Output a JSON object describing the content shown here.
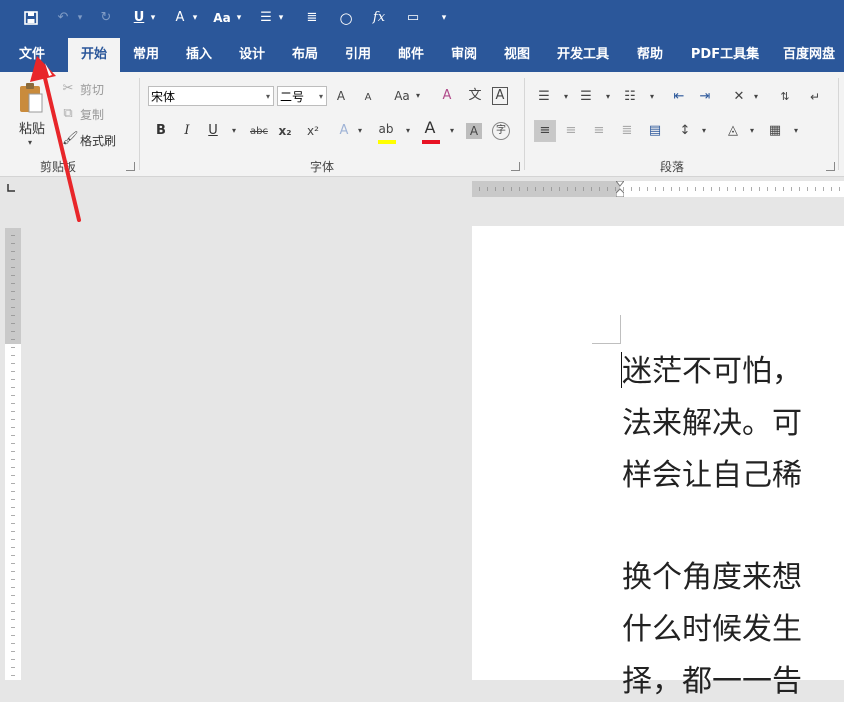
{
  "quick_access": {
    "icons": [
      "save-icon",
      "undo-icon",
      "redo-icon",
      "underline-icon",
      "text-effects-icon",
      "font-size-icon",
      "bullets-icon",
      "align-icon",
      "shape-icon",
      "formula-icon",
      "comment-icon",
      "customize-icon"
    ],
    "underline": "U",
    "font_case": "Aa",
    "formula": "fx"
  },
  "tabs": [
    "文件",
    "开始",
    "常用",
    "插入",
    "设计",
    "布局",
    "引用",
    "邮件",
    "审阅",
    "视图",
    "开发工具",
    "帮助",
    "PDF工具集",
    "百度网盘"
  ],
  "clipboard": {
    "group_label": "剪贴板",
    "paste": "粘贴",
    "cut": "剪切",
    "copy": "复制",
    "format_painter": "格式刷"
  },
  "font": {
    "group_label": "字体",
    "font_name": "宋体",
    "font_size": "二号",
    "grow": "A",
    "shrink": "A",
    "change_case": "Aa",
    "phonetic": "文",
    "border": "A",
    "bold": "B",
    "italic": "I",
    "underline": "U",
    "strikethrough": "abc",
    "subscript": "x₂",
    "superscript": "x²",
    "effects": "A",
    "highlight": "ab",
    "font_color": "A",
    "shading": "A",
    "enclose": "字"
  },
  "paragraph": {
    "group_label": "段落"
  },
  "document": {
    "lines": [
      "迷茫不可怕，",
      "法来解决。可",
      "样会让自己稀",
      "",
      "换个角度来想",
      "什么时候发生",
      "择，都一一告"
    ]
  },
  "colors": {
    "ribbon_blue": "#2b579a",
    "highlight_yellow": "#ffff00",
    "font_color_red": "#e81123",
    "arrow_red": "#e8262a"
  }
}
